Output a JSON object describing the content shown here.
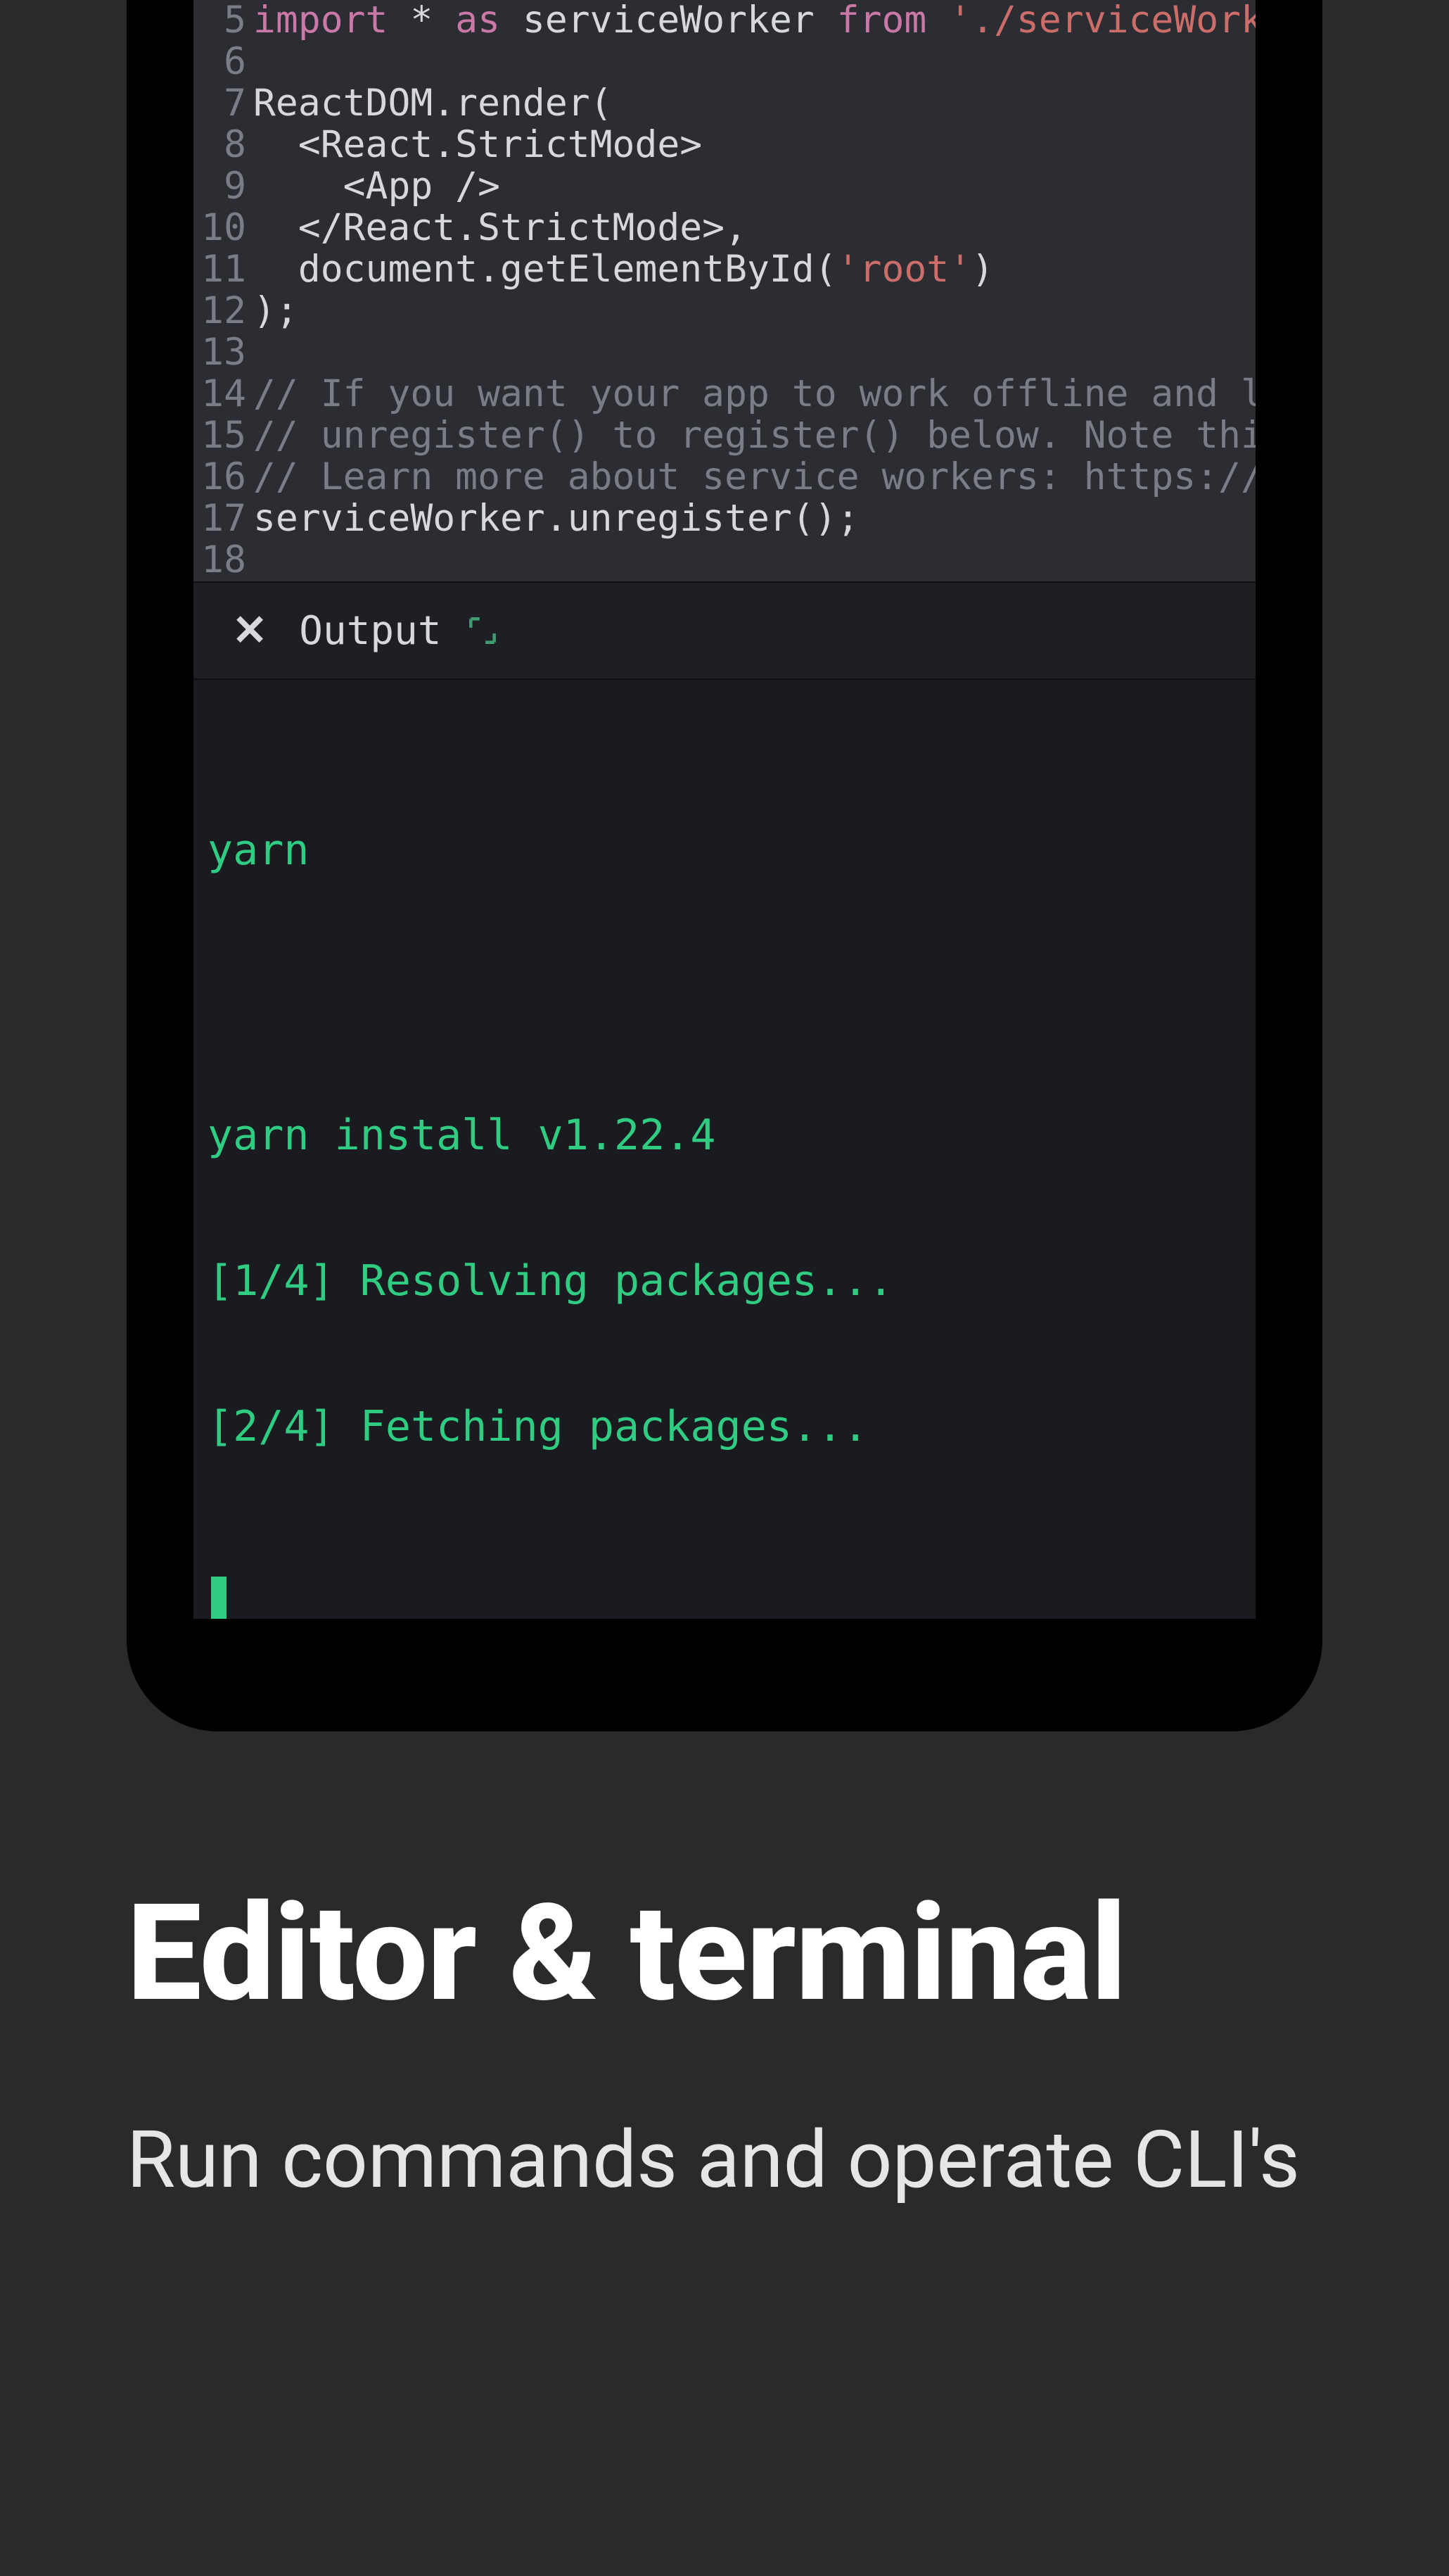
{
  "editor": {
    "lines": [
      {
        "n": 5,
        "html": "<span class='kw'>import</span> <span class='op'>*</span> <span class='kw'>as</span> serviceWorker <span class='kw'>from</span> <span class='str'>'./serviceWorker'</span>"
      },
      {
        "n": 6,
        "html": ""
      },
      {
        "n": 7,
        "html": "ReactDOM.render("
      },
      {
        "n": 8,
        "html": "  &lt;React.StrictMode&gt;"
      },
      {
        "n": 9,
        "html": "    &lt;App /&gt;"
      },
      {
        "n": 10,
        "html": "  &lt;/React.StrictMode&gt;,"
      },
      {
        "n": 11,
        "html": "  document.getElementById(<span class='str'>'root'</span>)"
      },
      {
        "n": 12,
        "html": ");"
      },
      {
        "n": 13,
        "html": ""
      },
      {
        "n": 14,
        "html": "<span class='cmt'>// If you want your app to work offline and load</span>"
      },
      {
        "n": 15,
        "html": "<span class='cmt'>// unregister() to register() below. Note this c</span>"
      },
      {
        "n": 16,
        "html": "<span class='cmt'>// Learn more about service workers: https://bit</span>"
      },
      {
        "n": 17,
        "html": "serviceWorker.unregister();"
      },
      {
        "n": 18,
        "html": ""
      }
    ]
  },
  "output": {
    "close_glyph": "✕",
    "label": "Output",
    "terminal": {
      "command": "yarn",
      "lines": [
        "yarn install v1.22.4",
        "[1/4] Resolving packages...",
        "[2/4] Fetching packages..."
      ]
    }
  },
  "promo": {
    "heading": "Editor & terminal",
    "sub": "Run commands and operate CLI's"
  }
}
